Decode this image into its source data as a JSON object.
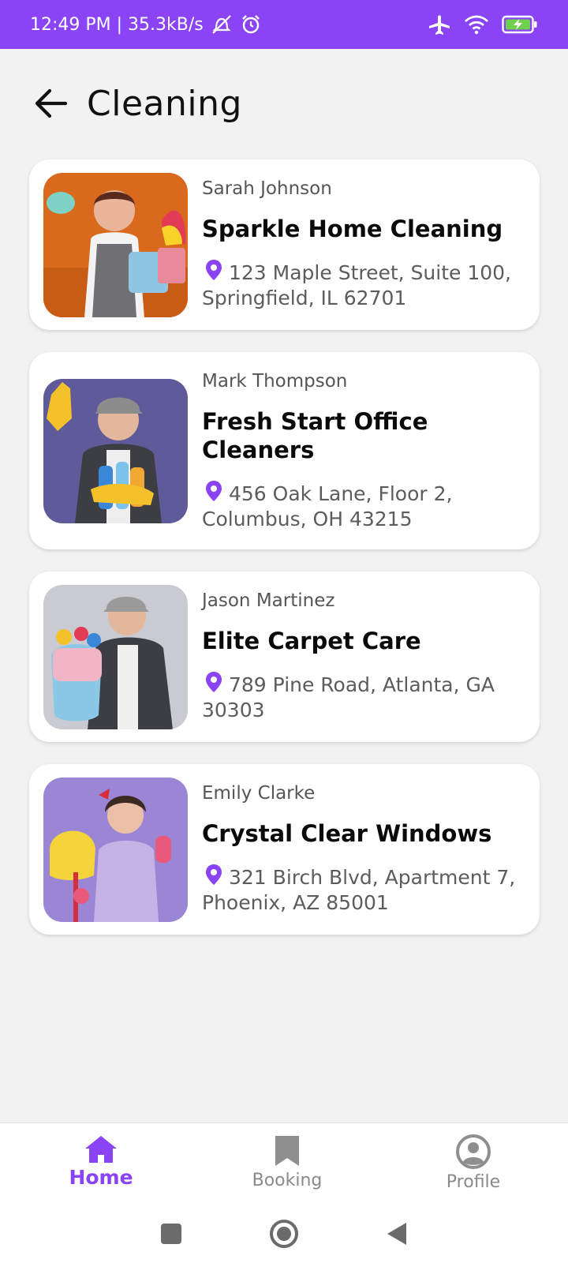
{
  "status_bar": {
    "time_speed": "12:49 PM | 35.3kB/s",
    "icons": [
      "muted-alarm-icon",
      "alarm-clock-icon",
      "airplane-icon",
      "wifi-icon",
      "battery-charging-icon"
    ]
  },
  "header": {
    "title": "Cleaning",
    "back_icon": "arrow-left-icon"
  },
  "colors": {
    "accent": "#8a44f5",
    "background": "#f2f2f3",
    "card": "#ffffff"
  },
  "services": [
    {
      "owner": "Sarah Johnson",
      "business": "Sparkle Home Cleaning",
      "address": "123 Maple Street, Suite 100, Springfield, IL 62701",
      "photo": "woman-with-cleaning-supplies-orange-background"
    },
    {
      "owner": "Mark Thompson",
      "business": "Fresh Start Office Cleaners",
      "address": "456 Oak Lane, Floor 2, Columbus, OH 43215",
      "photo": "man-with-gloves-purple-background"
    },
    {
      "owner": "Jason Martinez",
      "business": "Elite Carpet Care",
      "address": "789 Pine Road, Atlanta, GA 30303",
      "photo": "man-holding-cleaning-bucket-grey-background"
    },
    {
      "owner": "Emily Clarke",
      "business": "Crystal Clear Windows",
      "address": "321 Birch Blvd, Apartment 7, Phoenix, AZ 85001",
      "photo": "woman-with-mop-lavender-background"
    }
  ],
  "bottom_nav": {
    "items": [
      {
        "label": "Home",
        "icon": "home-icon",
        "active": true
      },
      {
        "label": "Booking",
        "icon": "bookmark-icon",
        "active": false
      },
      {
        "label": "Profile",
        "icon": "profile-icon",
        "active": false
      }
    ]
  },
  "system_nav": {
    "icons": [
      "recents-square-icon",
      "home-circle-icon",
      "back-triangle-icon"
    ]
  }
}
